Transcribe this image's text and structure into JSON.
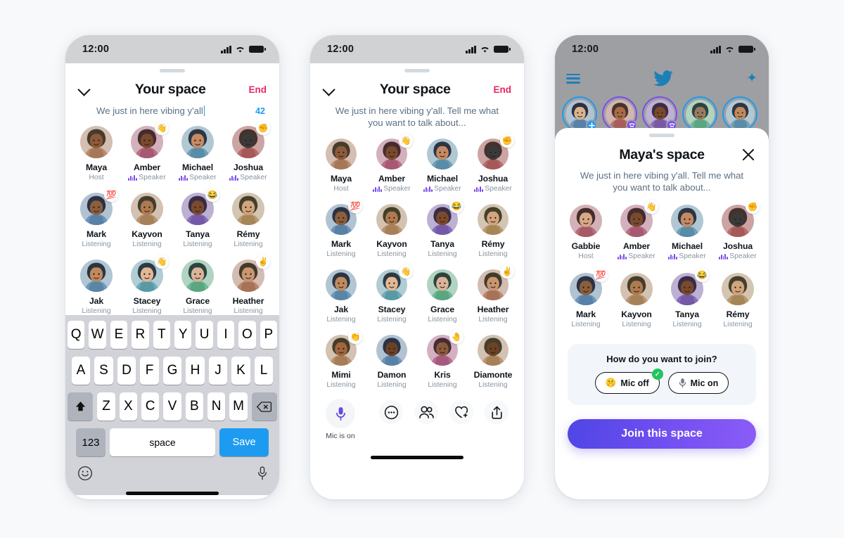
{
  "meta": {
    "bg_color": "#F7F9FB",
    "accent_purple": "#7B4DEA",
    "accent_blue": "#1D9BF0",
    "accent_pink": "#E8285F"
  },
  "status_bar": {
    "time": "12:00",
    "signal_icon": "cellular-bars-icon",
    "wifi_icon": "wifi-icon",
    "battery_icon": "battery-icon"
  },
  "phone1": {
    "title": "Your space",
    "end_label": "End",
    "chevron_icon": "chevron-down-icon",
    "description_value": "We just in here vibing y'all",
    "char_counter": "42",
    "members": [
      {
        "name": "Maya",
        "role": "Host",
        "type": "host",
        "reaction": "",
        "hue": 24,
        "skin": "#8D5A3B"
      },
      {
        "name": "Amber",
        "role": "Speaker",
        "type": "speaker",
        "reaction": "👋",
        "hue": 340,
        "skin": "#7A4A2E"
      },
      {
        "name": "Michael",
        "role": "Speaker",
        "type": "speaker",
        "reaction": "",
        "hue": 200,
        "skin": "#C68A63"
      },
      {
        "name": "Joshua",
        "role": "Speaker",
        "type": "speaker",
        "reaction": "✊",
        "hue": 0,
        "skin": "#3A3A3A"
      },
      {
        "name": "Mark",
        "role": "Listening",
        "type": "listener",
        "reaction": "💯",
        "hue": 210,
        "skin": "#8B5E3C"
      },
      {
        "name": "Kayvon",
        "role": "Listening",
        "type": "listener",
        "reaction": "",
        "hue": 30,
        "skin": "#B07A50"
      },
      {
        "name": "Tanya",
        "role": "Listening",
        "type": "listener",
        "reaction": "😂",
        "hue": 260,
        "skin": "#7A4A2E"
      },
      {
        "name": "Rémy",
        "role": "Listening",
        "type": "listener",
        "reaction": "",
        "hue": 35,
        "skin": "#D3A57D"
      },
      {
        "name": "Jak",
        "role": "Listening",
        "type": "listener",
        "reaction": "",
        "hue": 205,
        "skin": "#C08A5E"
      },
      {
        "name": "Stacey",
        "role": "Listening",
        "type": "listener",
        "reaction": "👋",
        "hue": 190,
        "skin": "#E3B795"
      },
      {
        "name": "Grace",
        "role": "Listening",
        "type": "listener",
        "reaction": "",
        "hue": 150,
        "skin": "#D9B49A"
      },
      {
        "name": "Heather",
        "role": "Listening",
        "type": "listener",
        "reaction": "✌️",
        "hue": 20,
        "skin": "#C99670"
      }
    ],
    "keyboard": {
      "row1": [
        "Q",
        "W",
        "E",
        "R",
        "T",
        "Y",
        "U",
        "I",
        "O",
        "P"
      ],
      "row2": [
        "A",
        "S",
        "D",
        "F",
        "G",
        "H",
        "J",
        "K",
        "L"
      ],
      "row3": [
        "Z",
        "X",
        "C",
        "V",
        "B",
        "N",
        "M"
      ],
      "shift_icon": "shift-arrow-icon",
      "backspace_icon": "backspace-icon",
      "numbers_label": "123",
      "space_label": "space",
      "save_label": "Save",
      "emoji_icon": "emoji-smiley-icon",
      "dictation_icon": "microphone-icon"
    }
  },
  "phone2": {
    "title": "Your space",
    "end_label": "End",
    "chevron_icon": "chevron-down-icon",
    "description": "We just in here vibing y'all. Tell me what you want to talk about...",
    "members": [
      {
        "name": "Maya",
        "role": "Host",
        "type": "host",
        "reaction": "",
        "hue": 24,
        "skin": "#8D5A3B"
      },
      {
        "name": "Amber",
        "role": "Speaker",
        "type": "speaker",
        "reaction": "👋",
        "hue": 340,
        "skin": "#7A4A2E"
      },
      {
        "name": "Michael",
        "role": "Speaker",
        "type": "speaker",
        "reaction": "",
        "hue": 200,
        "skin": "#C68A63"
      },
      {
        "name": "Joshua",
        "role": "Speaker",
        "type": "speaker",
        "reaction": "✊",
        "hue": 0,
        "skin": "#3A3A3A"
      },
      {
        "name": "Mark",
        "role": "Listening",
        "type": "listener",
        "reaction": "💯",
        "hue": 210,
        "skin": "#8B5E3C"
      },
      {
        "name": "Kayvon",
        "role": "Listening",
        "type": "listener",
        "reaction": "",
        "hue": 30,
        "skin": "#B07A50"
      },
      {
        "name": "Tanya",
        "role": "Listening",
        "type": "listener",
        "reaction": "😂",
        "hue": 260,
        "skin": "#7A4A2E"
      },
      {
        "name": "Rémy",
        "role": "Listening",
        "type": "listener",
        "reaction": "",
        "hue": 35,
        "skin": "#D3A57D"
      },
      {
        "name": "Jak",
        "role": "Listening",
        "type": "listener",
        "reaction": "",
        "hue": 205,
        "skin": "#C08A5E"
      },
      {
        "name": "Stacey",
        "role": "Listening",
        "type": "listener",
        "reaction": "👋",
        "hue": 190,
        "skin": "#E3B795"
      },
      {
        "name": "Grace",
        "role": "Listening",
        "type": "listener",
        "reaction": "",
        "hue": 150,
        "skin": "#D9B49A"
      },
      {
        "name": "Heather",
        "role": "Listening",
        "type": "listener",
        "reaction": "✌️",
        "hue": 20,
        "skin": "#C99670"
      },
      {
        "name": "Mimi",
        "role": "Listening",
        "type": "listener",
        "reaction": "👏",
        "hue": 28,
        "skin": "#A0663F"
      },
      {
        "name": "Damon",
        "role": "Listening",
        "type": "listener",
        "reaction": "",
        "hue": 210,
        "skin": "#6B4226"
      },
      {
        "name": "Kris",
        "role": "Listening",
        "type": "listener",
        "reaction": "🤚",
        "hue": 330,
        "skin": "#8B5A3C"
      },
      {
        "name": "Diamonte",
        "role": "Listening",
        "type": "listener",
        "reaction": "",
        "hue": 30,
        "skin": "#6B4226"
      }
    ],
    "bottom": {
      "mic_icon": "microphone-icon",
      "mic_label": "Mic is on",
      "actions": [
        {
          "icon": "more-dots-icon"
        },
        {
          "icon": "people-icon"
        },
        {
          "icon": "heart-plus-icon"
        },
        {
          "icon": "share-upload-icon"
        }
      ]
    }
  },
  "phone3": {
    "twitter_header": {
      "menu_icon": "hamburger-menu-icon",
      "logo_icon": "twitter-bird-icon",
      "sparkle_icon": "sparkle-icon",
      "fleets": [
        {
          "kind": "your-fleet",
          "ring": "blue",
          "badge": "plus"
        },
        {
          "kind": "space",
          "ring": "purple",
          "badge": "space"
        },
        {
          "kind": "space",
          "ring": "purple",
          "badge": "space"
        },
        {
          "kind": "fleet",
          "ring": "blue",
          "badge": ""
        },
        {
          "kind": "fleet",
          "ring": "blue",
          "badge": ""
        }
      ]
    },
    "title": "Maya's space",
    "close_icon": "close-x-icon",
    "description": "We just in here vibing y'all. Tell me what you want to talk about...",
    "members": [
      {
        "name": "Gabbie",
        "role": "Host",
        "type": "host",
        "reaction": "",
        "hue": 350,
        "skin": "#D8A887"
      },
      {
        "name": "Amber",
        "role": "Speaker",
        "type": "speaker",
        "reaction": "👋",
        "hue": 340,
        "skin": "#7A4A2E"
      },
      {
        "name": "Michael",
        "role": "Speaker",
        "type": "speaker",
        "reaction": "",
        "hue": 200,
        "skin": "#C68A63"
      },
      {
        "name": "Joshua",
        "role": "Speaker",
        "type": "speaker",
        "reaction": "✊",
        "hue": 0,
        "skin": "#3A3A3A"
      },
      {
        "name": "Mark",
        "role": "Listening",
        "type": "listener",
        "reaction": "💯",
        "hue": 210,
        "skin": "#8B5E3C"
      },
      {
        "name": "Kayvon",
        "role": "Listening",
        "type": "listener",
        "reaction": "",
        "hue": 30,
        "skin": "#B07A50"
      },
      {
        "name": "Tanya",
        "role": "Listening",
        "type": "listener",
        "reaction": "😂",
        "hue": 260,
        "skin": "#7A4A2E"
      },
      {
        "name": "Rémy",
        "role": "Listening",
        "type": "listener",
        "reaction": "",
        "hue": 35,
        "skin": "#D3A57D"
      }
    ],
    "join_card": {
      "question": "How do you want to join?",
      "mic_off_label": "Mic off",
      "mic_off_emoji": "🤫",
      "mic_off_selected": true,
      "check_glyph": "✓",
      "mic_on_label": "Mic on",
      "mic_on_icon": "microphone-icon"
    },
    "join_button_label": "Join this space"
  }
}
